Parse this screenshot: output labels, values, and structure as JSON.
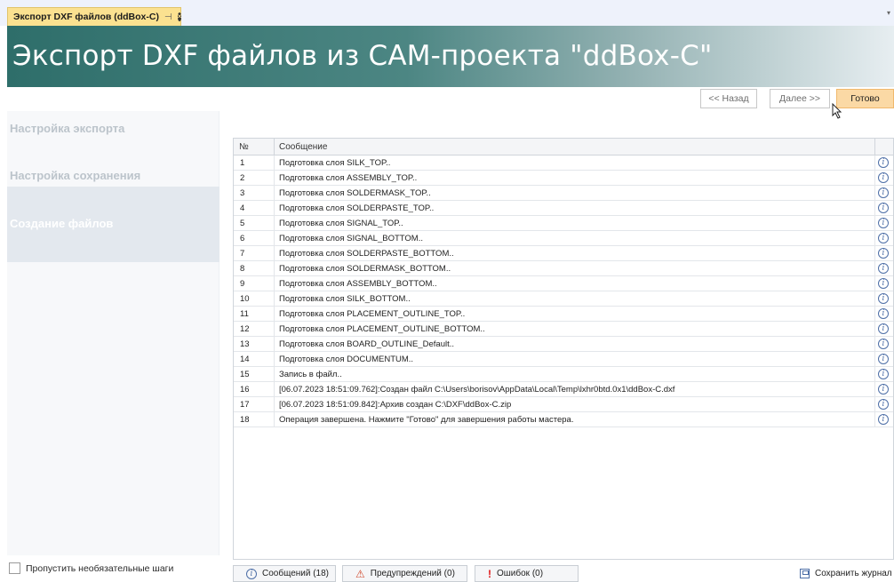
{
  "tab": {
    "title": "Экспорт DXF файлов (ddBox-C)",
    "pin_glyph": "⊣",
    "close_glyph": "×",
    "overflow_glyph": "▾"
  },
  "banner": {
    "title": "Экспорт DXF файлов из CAM-проекта \"ddBox-C\""
  },
  "nav": {
    "back_label": "<< Назад",
    "next_label": "Далее >>",
    "done_label": "Готово"
  },
  "steps": [
    {
      "label": "Настройка экспорта"
    },
    {
      "label": "Настройка сохранения"
    },
    {
      "label": "Создание файлов",
      "active": true
    }
  ],
  "skip_optional": {
    "label": "Пропустить необязательные шаги",
    "checked": false
  },
  "grid": {
    "columns": {
      "no": "№",
      "message": "Сообщение"
    },
    "info_glyph": "i",
    "rows": [
      {
        "no": "1",
        "message": "Подготовка слоя SILK_TOP.."
      },
      {
        "no": "2",
        "message": "Подготовка слоя ASSEMBLY_TOP.."
      },
      {
        "no": "3",
        "message": "Подготовка слоя SOLDERMASK_TOP.."
      },
      {
        "no": "4",
        "message": "Подготовка слоя SOLDERPASTE_TOP.."
      },
      {
        "no": "5",
        "message": "Подготовка слоя SIGNAL_TOP.."
      },
      {
        "no": "6",
        "message": "Подготовка слоя SIGNAL_BOTTOM.."
      },
      {
        "no": "7",
        "message": "Подготовка слоя SOLDERPASTE_BOTTOM.."
      },
      {
        "no": "8",
        "message": "Подготовка слоя SOLDERMASK_BOTTOM.."
      },
      {
        "no": "9",
        "message": "Подготовка слоя ASSEMBLY_BOTTOM.."
      },
      {
        "no": "10",
        "message": "Подготовка слоя SILK_BOTTOM.."
      },
      {
        "no": "11",
        "message": "Подготовка слоя PLACEMENT_OUTLINE_TOP.."
      },
      {
        "no": "12",
        "message": "Подготовка слоя PLACEMENT_OUTLINE_BOTTOM.."
      },
      {
        "no": "13",
        "message": "Подготовка слоя BOARD_OUTLINE_Default.."
      },
      {
        "no": "14",
        "message": "Подготовка слоя DOCUMENTUM.."
      },
      {
        "no": "15",
        "message": "Запись в файл.."
      },
      {
        "no": "16",
        "message": "[06.07.2023 18:51:09.762]:Создан файл C:\\Users\\borisov\\AppData\\Local\\Temp\\lxhr0btd.0x1\\ddBox-C.dxf"
      },
      {
        "no": "17",
        "message": "[06.07.2023 18:51:09.842]:Архив создан C:\\DXF\\ddBox-C.zip"
      },
      {
        "no": "18",
        "message": "Операция завершена. Нажмите \"Готово\" для завершения работы мастера."
      }
    ]
  },
  "filters": {
    "messages": {
      "label": "Сообщений (18)",
      "glyph": "i"
    },
    "warnings": {
      "label": "Предупреждений (0)",
      "glyph": "⚠"
    },
    "errors": {
      "label": "Ошибок (0)",
      "glyph": "!"
    }
  },
  "save_log": {
    "label": "Сохранить журнал"
  }
}
